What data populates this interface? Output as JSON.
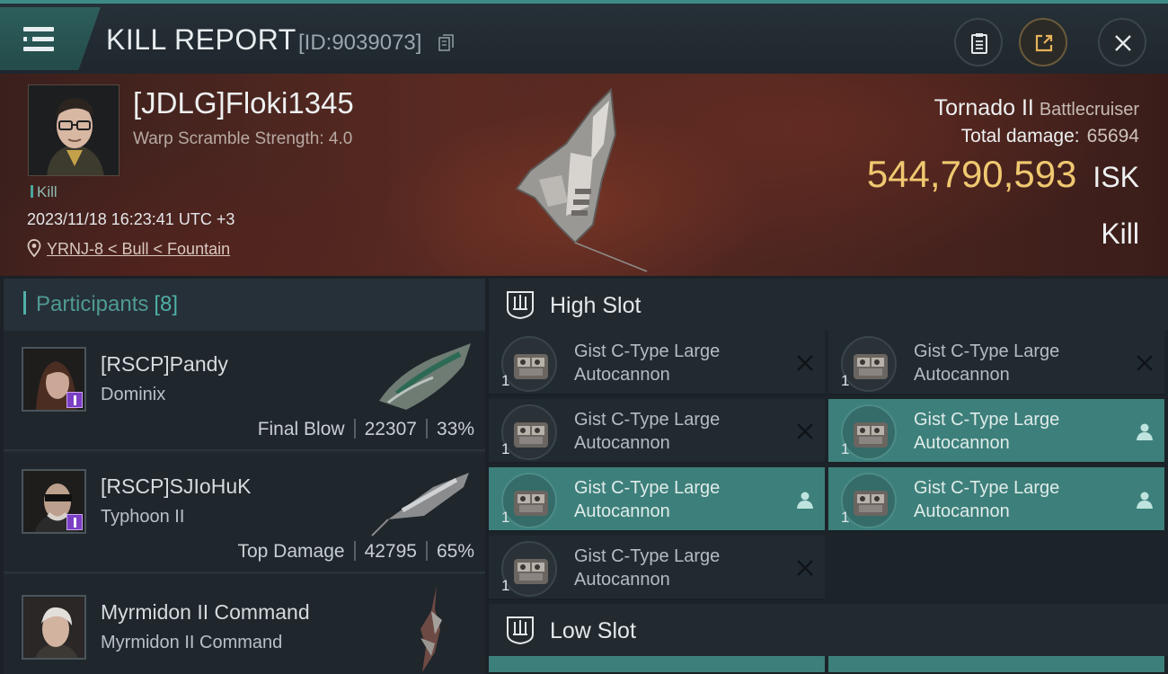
{
  "header": {
    "title": "KILL REPORT",
    "report_id": "[ID:9039073]"
  },
  "victim": {
    "name": "[JDLG]Floki1345",
    "subtitle": "Warp Scramble Strength: 4.0",
    "tag": "Kill",
    "datetime": "2023/11/18 16:23:41 UTC +3",
    "location": "YRNJ-8 < Bull < Fountain",
    "ship_name": "Tornado II",
    "ship_class": "Battlecruiser",
    "total_damage_label": "Total damage:",
    "total_damage": "65694",
    "isk_value": "544,790,593",
    "isk_unit": "ISK",
    "result": "Kill"
  },
  "participants": {
    "title": "Participants",
    "count": "[8]",
    "rows": [
      {
        "name": "[RSCP]Pandy",
        "ship": "Dominix",
        "stat_label": "Final Blow",
        "damage": "22307",
        "percent": "33%"
      },
      {
        "name": "[RSCP]SJIoHuK",
        "ship": "Typhoon II",
        "stat_label": "Top Damage",
        "damage": "42795",
        "percent": "65%"
      },
      {
        "name": "Myrmidon II Command",
        "ship": "Myrmidon II Command",
        "stat_label": "",
        "damage": "",
        "percent": ""
      }
    ]
  },
  "slots": {
    "high_slot_label": "High Slot",
    "low_slot_label": "Low Slot",
    "high_modules": [
      {
        "name": "Gist C-Type Large Autocannon",
        "qty": "1",
        "state": "destroyed"
      },
      {
        "name": "Gist C-Type Large Autocannon",
        "qty": "1",
        "state": "destroyed"
      },
      {
        "name": "Gist C-Type Large Autocannon",
        "qty": "1",
        "state": "destroyed"
      },
      {
        "name": "Gist C-Type Large Autocannon",
        "qty": "1",
        "state": "dropped"
      },
      {
        "name": "Gist C-Type Large Autocannon",
        "qty": "1",
        "state": "dropped"
      },
      {
        "name": "Gist C-Type Large Autocannon",
        "qty": "1",
        "state": "dropped"
      },
      {
        "name": "Gist C-Type Large Autocannon",
        "qty": "1",
        "state": "destroyed"
      }
    ]
  },
  "colors": {
    "accent": "#4fb0a7",
    "isk": "#f0c870",
    "fitted_bg": "#3d7f7b"
  },
  "icons": [
    "menu-icon",
    "copy-icon",
    "clipboard-icon",
    "share-icon",
    "close-icon",
    "location-pin-icon",
    "high-slot-icon",
    "low-slot-icon",
    "destroyed-icon",
    "dropped-icon"
  ]
}
